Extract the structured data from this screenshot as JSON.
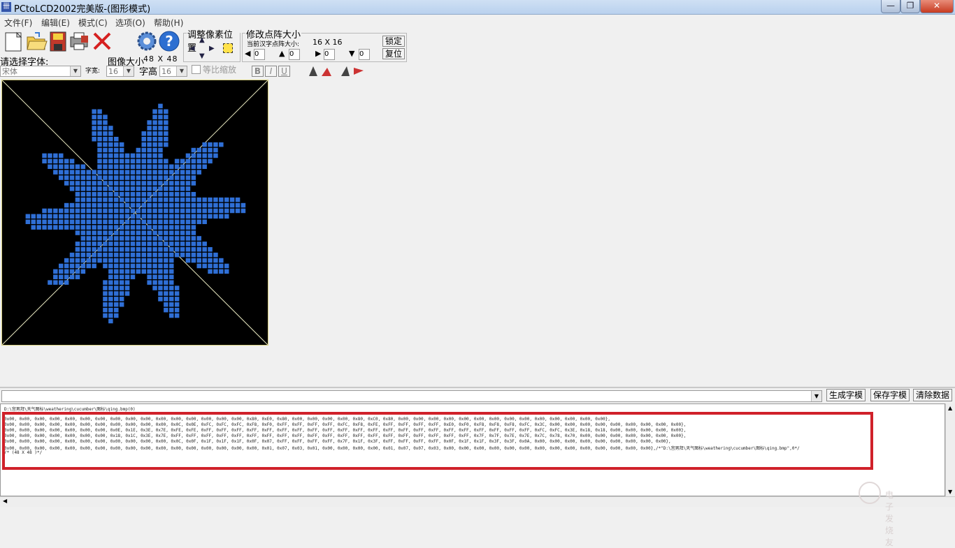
{
  "window": {
    "title": "PCtoLCD2002完美版-(图形模式)",
    "app_icon_text": "卌"
  },
  "menu": [
    {
      "label": "文件(F)"
    },
    {
      "label": "编辑(E)"
    },
    {
      "label": "模式(C)"
    },
    {
      "label": "选项(O)"
    },
    {
      "label": "帮助(H)"
    }
  ],
  "font": {
    "select_label": "请选择字体:",
    "font_value": "宋体",
    "char_width_label": "字宽:",
    "char_width_value": "16",
    "char_height_label": "字高",
    "char_height_value": "16",
    "proportional_label": "等比缩放"
  },
  "image_size": {
    "label": "图像大小",
    "value": "48 X 48"
  },
  "pixel_adjust": {
    "legend": "调整像素位置"
  },
  "matrix_size": {
    "legend": "修改点阵大小",
    "current_label": "当前汉字点阵大小:",
    "current_value": "16 X 16",
    "lock_button": "锁定",
    "reset_button": "复位",
    "spin_values": [
      "0",
      "0",
      "0",
      "0"
    ]
  },
  "style_buttons": {
    "bold": "B",
    "italic": "I",
    "underline": "U"
  },
  "output": {
    "path_header": "D:\\宫男拜\\天气图标\\weathering\\cucumber\\图标\\qing.bmp(0)",
    "generate_button": "生成字模",
    "save_button": "保存字模",
    "clear_button": "清除数据",
    "lines": [
      "0x00, 0x00, 0x00, 0x00, 0x00, 0x00, 0x00, 0x00, 0x00, 0x00, 0x00, 0x00, 0x00, 0x00, 0x00, 0x00, 0x80, 0xE0, 0x80, 0x00, 0x00, 0x00, 0x00, 0x80, 0xC0, 0x80, 0x00, 0x00, 0x00, 0x00, 0x00, 0x00, 0x00, 0x00, 0x00, 0x00, 0x00, 0x00, 0x00, 0x00},",
      "0x00, 0x00, 0x00, 0x00, 0x00, 0x00, 0x00, 0x00, 0x00, 0x00, 0x00, 0x0C, 0x0E, 0xFC, 0xFC, 0xFC, 0xF8, 0xF0, 0xFF, 0xFF, 0xFF, 0xFF, 0xFC, 0xF8, 0xFE, 0xFF, 0xFF, 0xFF, 0xFF, 0xE0, 0xF0, 0xF8, 0xF8, 0xF8, 0xFC, 0x3C, 0x00, 0x00, 0x00, 0x00, 0x00, 0x00, 0x00, 0x00, 0x00},",
      "0x00, 0x00, 0x00, 0x00, 0x00, 0x00, 0x00, 0x0E, 0x1E, 0x3E, 0x7E, 0xFE, 0xFE, 0xFF, 0xFF, 0xFF, 0xFF, 0xFF, 0xFF, 0xFF, 0xFF, 0xFF, 0xFF, 0xFF, 0xFF, 0xFF, 0xFF, 0xFF, 0xFF, 0xFF, 0xFF, 0xFF, 0xFF, 0xFF, 0xFF, 0xFC, 0xFC, 0x3E, 0x18, 0x18, 0x00, 0x00, 0x00, 0x00, 0x00},",
      "0x00, 0x00, 0x00, 0x00, 0x00, 0x00, 0x00, 0x18, 0x1C, 0x3E, 0x7E, 0xFF, 0xFF, 0xFF, 0xFF, 0xFF, 0xFF, 0xFF, 0xFF, 0xFF, 0xFF, 0xFF, 0xFF, 0xFF, 0xFF, 0xFF, 0xFF, 0xFF, 0xFF, 0xFF, 0xFF, 0x7F, 0x7F, 0x7E, 0x7E, 0x7C, 0x78, 0x70, 0x00, 0x00, 0x00, 0x00, 0x00, 0x00, 0x00},",
      "0x00, 0x00, 0x00, 0x00, 0x00, 0x00, 0x00, 0x00, 0x00, 0x00, 0x00, 0x0C, 0x0F, 0x1F, 0x1F, 0x1F, 0x0F, 0x07, 0xFF, 0xFF, 0xFF, 0xFF, 0x7F, 0x1F, 0x3F, 0xFF, 0xFF, 0xFF, 0xFF, 0x0F, 0x1F, 0x1F, 0x3F, 0x3F, 0x0A, 0x00, 0x00, 0x00, 0x00, 0x00, 0x00, 0x00, 0x00, 0x00},",
      "0x00, 0x00, 0x00, 0x00, 0x00, 0x00, 0x00, 0x00, 0x00, 0x00, 0x00, 0x00, 0x00, 0x00, 0x00, 0x00, 0x00, 0x01, 0x07, 0x03, 0x01, 0x00, 0x00, 0x00, 0x00, 0x01, 0x07, 0x07, 0x03, 0x00, 0x00, 0x00, 0x00, 0x00, 0x00, 0x00, 0x00, 0x00, 0x00, 0x00, 0x00, 0x00, 0x00},/*\"D:\\宫男拜\\天气图标\\weathering\\cucumber\\图标\\qing.bmp\",0*/",
      "/* (48 X 48 )*/"
    ]
  },
  "watermark": {
    "text": "电子发烧友"
  },
  "colors": {
    "pixel": "#2f6fd6",
    "canvas_bg": "#000000",
    "highlight": "#d0212a",
    "diagonal": "#e8e8c0"
  },
  "icons": [
    "new-file-icon",
    "open-folder-icon",
    "save-disk-icon",
    "print-icon",
    "delete-icon",
    "gear-icon",
    "help-icon"
  ]
}
